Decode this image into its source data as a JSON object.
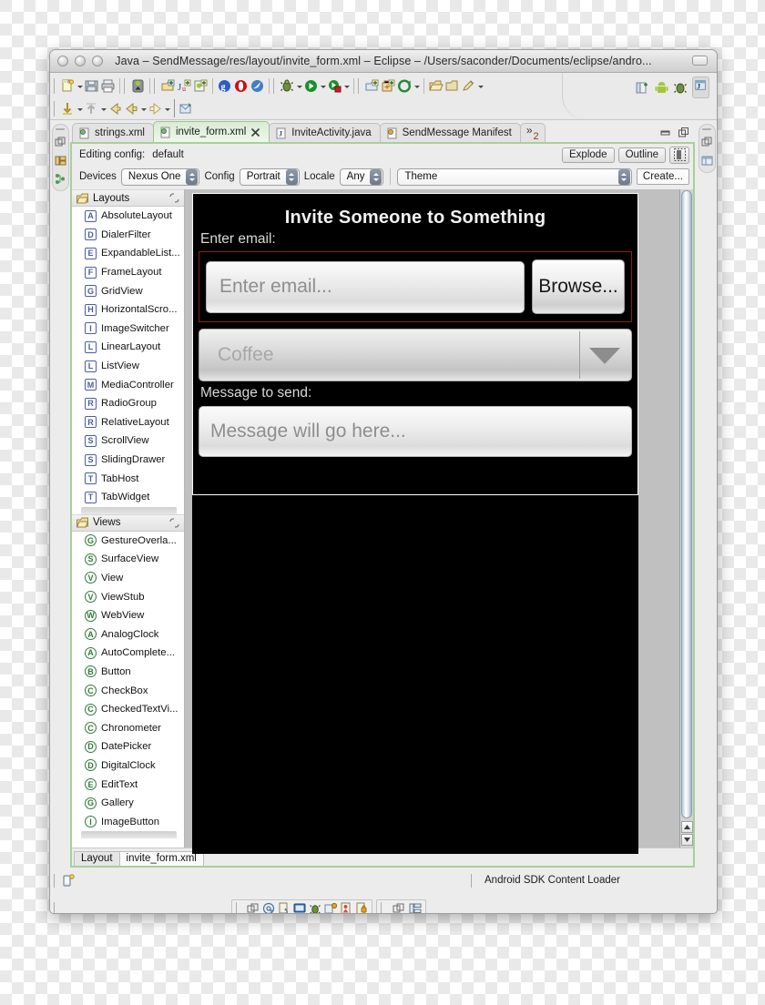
{
  "window": {
    "title": "Java – SendMessage/res/layout/invite_form.xml – Eclipse – /Users/saconder/Documents/eclipse/andro...",
    "traffic_lights": [
      "close",
      "minimize",
      "zoom"
    ]
  },
  "toolbar": {
    "row1_icons": [
      "new-wizard-icon",
      "save-icon",
      "print-icon",
      "android-sdk-manager-icon",
      "new-package-icon",
      "new-junit-test-icon",
      "new-android-xml-icon",
      "google-icon",
      "opera-icon",
      "dolphin-browser-icon",
      "debug-icon",
      "run-icon",
      "profile-icon",
      "new-java-project-icon",
      "new-class-icon",
      "git-icon",
      "open-folder-icon",
      "open-type-icon",
      "pencil-icon"
    ],
    "row2_icons": [
      "step-down-icon",
      "step-up-icon",
      "back-icon",
      "previous-icon",
      "next-icon",
      "annotation-icon"
    ],
    "perspective_icons": [
      "open-perspective-icon",
      "android-perspective-icon",
      "debug-perspective-icon",
      "java-perspective-icon"
    ]
  },
  "tabs": [
    {
      "label": "strings.xml",
      "icon": "xml-file-icon",
      "active": false,
      "dirty": false
    },
    {
      "label": "invite_form.xml",
      "icon": "layout-file-icon",
      "active": true,
      "dirty": true
    },
    {
      "label": "InviteActivity.java",
      "icon": "java-file-icon",
      "active": false,
      "dirty": false
    },
    {
      "label": "SendMessage Manifest",
      "icon": "manifest-file-icon",
      "active": false,
      "dirty": false
    }
  ],
  "tab_overflow": {
    "chevron": "»",
    "count": "2"
  },
  "editor_controls": {
    "minimize": "minimize-icon",
    "maximize": "maximize-icon"
  },
  "config": {
    "editing_config_label": "Editing config:",
    "editing_config_value": "default",
    "explode_label": "Explode",
    "outline_label": "Outline",
    "devices_label": "Devices",
    "devices_value": "Nexus One",
    "config_label": "Config",
    "config_value": "Portrait",
    "locale_label": "Locale",
    "locale_value": "Any",
    "theme_value": "Theme",
    "create_label": "Create..."
  },
  "palette": {
    "groups": [
      {
        "name": "Layouts",
        "items": [
          {
            "label": "AbsoluteLayout",
            "badge": "A",
            "shape": "sq"
          },
          {
            "label": "DialerFilter",
            "badge": "D",
            "shape": "sq"
          },
          {
            "label": "ExpandableList...",
            "badge": "E",
            "shape": "sq"
          },
          {
            "label": "FrameLayout",
            "badge": "F",
            "shape": "sq"
          },
          {
            "label": "GridView",
            "badge": "G",
            "shape": "sq"
          },
          {
            "label": "HorizontalScro...",
            "badge": "H",
            "shape": "sq"
          },
          {
            "label": "ImageSwitcher",
            "badge": "I",
            "shape": "sq"
          },
          {
            "label": "LinearLayout",
            "badge": "L",
            "shape": "sq"
          },
          {
            "label": "ListView",
            "badge": "L",
            "shape": "sq"
          },
          {
            "label": "MediaController",
            "badge": "M",
            "shape": "sq"
          },
          {
            "label": "RadioGroup",
            "badge": "R",
            "shape": "sq"
          },
          {
            "label": "RelativeLayout",
            "badge": "R",
            "shape": "sq"
          },
          {
            "label": "ScrollView",
            "badge": "S",
            "shape": "sq"
          },
          {
            "label": "SlidingDrawer",
            "badge": "S",
            "shape": "sq"
          },
          {
            "label": "TabHost",
            "badge": "T",
            "shape": "sq"
          },
          {
            "label": "TabWidget",
            "badge": "T",
            "shape": "sq"
          }
        ]
      },
      {
        "name": "Views",
        "items": [
          {
            "label": "GestureOverla...",
            "badge": "G",
            "shape": "ci"
          },
          {
            "label": "SurfaceView",
            "badge": "S",
            "shape": "ci"
          },
          {
            "label": "View",
            "badge": "V",
            "shape": "ci"
          },
          {
            "label": "ViewStub",
            "badge": "V",
            "shape": "ci"
          },
          {
            "label": "WebView",
            "badge": "W",
            "shape": "ci"
          },
          {
            "label": "AnalogClock",
            "badge": "A",
            "shape": "ci"
          },
          {
            "label": "AutoComplete...",
            "badge": "A",
            "shape": "ci"
          },
          {
            "label": "Button",
            "badge": "B",
            "shape": "ci"
          },
          {
            "label": "CheckBox",
            "badge": "C",
            "shape": "ci"
          },
          {
            "label": "CheckedTextVi...",
            "badge": "C",
            "shape": "ci"
          },
          {
            "label": "Chronometer",
            "badge": "C",
            "shape": "ci"
          },
          {
            "label": "DatePicker",
            "badge": "D",
            "shape": "ci"
          },
          {
            "label": "DigitalClock",
            "badge": "D",
            "shape": "ci"
          },
          {
            "label": "EditText",
            "badge": "E",
            "shape": "ci"
          },
          {
            "label": "Gallery",
            "badge": "G",
            "shape": "ci"
          },
          {
            "label": "ImageButton",
            "badge": "I",
            "shape": "ci"
          }
        ]
      }
    ],
    "collapse_icon": "collapse-all-icon",
    "folder_icon": "folder-icon"
  },
  "preview": {
    "title": "Invite Someone to Something",
    "email_label": "Enter email:",
    "email_placeholder": "Enter email...",
    "browse_label": "Browse...",
    "spinner_value": "Coffee",
    "message_label": "Message to send:",
    "message_placeholder": "Message will go here...",
    "background": "#000000",
    "selection_border": "#8b1e1e"
  },
  "bottom_tabs": [
    {
      "label": "Layout",
      "active": false
    },
    {
      "label": "invite_form.xml",
      "active": true
    }
  ],
  "status": {
    "left_icon": "smartphone-status-icon",
    "job_text": "Android SDK Content Loader"
  },
  "bottom_toolbar": {
    "group1": [
      "link-icon",
      "at-icon",
      "refresh-doc-icon",
      "console-icon",
      "debug-bug-icon",
      "breakpoint-icon",
      "variables-icon",
      "lock-icon"
    ],
    "group2": [
      "collapse-icon",
      "hierarchy-icon"
    ]
  }
}
